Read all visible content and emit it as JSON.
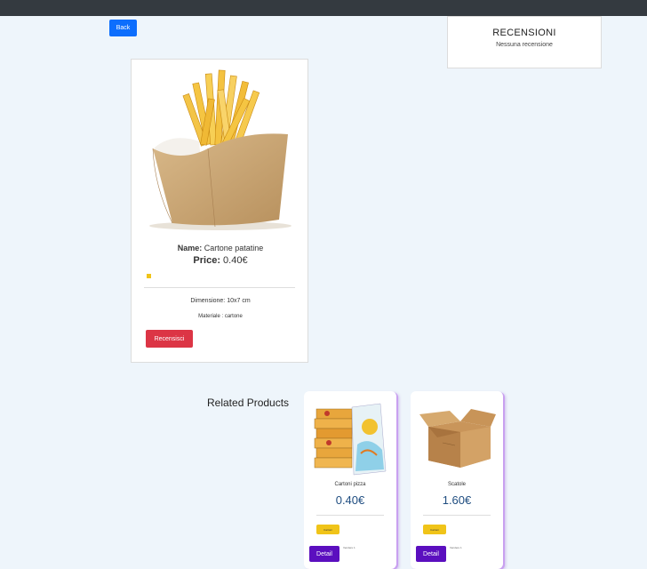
{
  "navbar": {},
  "back_label": "Back",
  "reviews": {
    "title": "RECENSIONI",
    "empty_text": "Nessuna recensione"
  },
  "product": {
    "name_label": "Name:",
    "name": "Cartone patatine",
    "price_label": "Price:",
    "price": "0.40€",
    "dimension": "Dimensione: 10x7 cm",
    "material": "Materiale : cartone",
    "review_button": "Recensisci",
    "image_icon": "fries-box-image"
  },
  "related": {
    "title": "Related Products",
    "items": [
      {
        "name": "Cartoni pizza",
        "price": "0.40€",
        "category": "Cartoni",
        "detail": "Detail",
        "note": "Vendere 1",
        "image_icon": "pizza-boxes-image"
      },
      {
        "name": "Scatole",
        "price": "1.60€",
        "category": "Cartoni",
        "detail": "Detail",
        "note": "Vendere 1",
        "image_icon": "cardboard-box-image"
      }
    ]
  },
  "colors": {
    "navbar": "#343a40",
    "back": "#0d6efd",
    "review": "#dc3545",
    "detail": "#5b0fbf",
    "tag": "#f0c419",
    "bg": "#eef5fb"
  }
}
